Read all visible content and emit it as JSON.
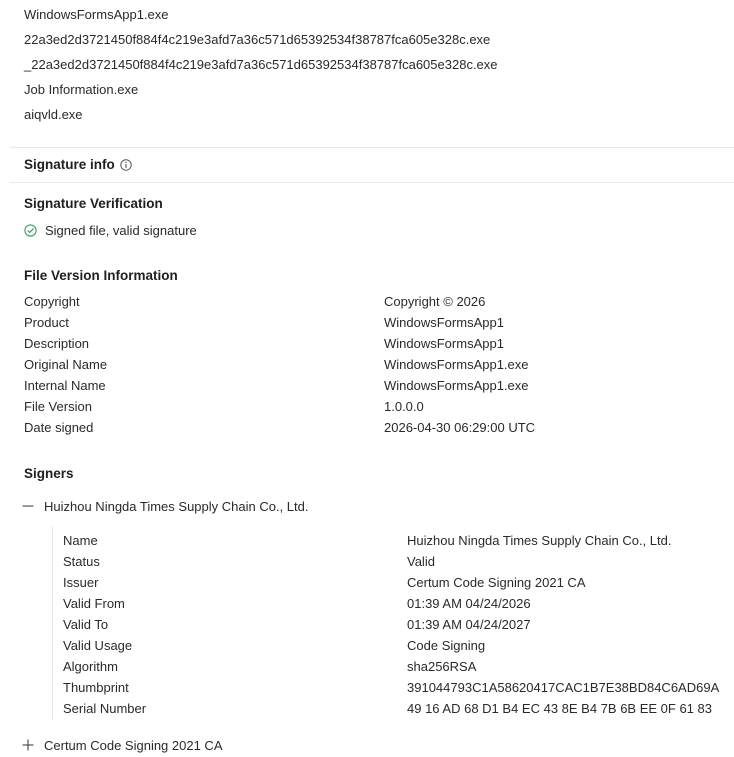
{
  "names": [
    "WindowsFormsApp1.exe",
    "22a3ed2d3721450f884f4c219e3afd7a36c571d65392534f38787fca605e328c.exe",
    "_22a3ed2d3721450f884f4c219e3afd7a36c571d65392534f38787fca605e328c.exe",
    "Job Information.exe",
    "aiqvld.exe"
  ],
  "signature_info": {
    "title": "Signature info",
    "info_icon": "info-circle-icon"
  },
  "signature_verification": {
    "title": "Signature Verification",
    "status_icon": "check-circle-icon",
    "status_color": "#3a9b5c",
    "status_text": "Signed file, valid signature"
  },
  "file_version_info": {
    "title": "File Version Information",
    "rows": [
      {
        "key": "Copyright",
        "value": "Copyright © 2026"
      },
      {
        "key": "Product",
        "value": "WindowsFormsApp1"
      },
      {
        "key": "Description",
        "value": "WindowsFormsApp1"
      },
      {
        "key": "Original Name",
        "value": "WindowsFormsApp1.exe"
      },
      {
        "key": "Internal Name",
        "value": "WindowsFormsApp1.exe"
      },
      {
        "key": "File Version",
        "value": "1.0.0.0"
      },
      {
        "key": "Date signed",
        "value": "2026-04-30 06:29:00 UTC"
      }
    ]
  },
  "signers": {
    "title": "Signers",
    "items": [
      {
        "name": "Huizhou Ningda Times Supply Chain Co., Ltd.",
        "expanded": true,
        "toggle_icon": "minus-icon",
        "details": [
          {
            "key": "Name",
            "value": "Huizhou Ningda Times Supply Chain Co., Ltd."
          },
          {
            "key": "Status",
            "value": "Valid"
          },
          {
            "key": "Issuer",
            "value": "Certum Code Signing 2021 CA"
          },
          {
            "key": "Valid From",
            "value": "01:39 AM 04/24/2026"
          },
          {
            "key": "Valid To",
            "value": "01:39 AM 04/24/2027"
          },
          {
            "key": "Valid Usage",
            "value": "Code Signing"
          },
          {
            "key": "Algorithm",
            "value": "sha256RSA"
          },
          {
            "key": "Thumbprint",
            "value": "391044793C1A58620417CAC1B7E38BD84C6AD69A"
          },
          {
            "key": "Serial Number",
            "value": "49 16 AD 68 D1 B4 EC 43 8E B4 7B 6B EE 0F 61 83"
          }
        ]
      },
      {
        "name": "Certum Code Signing 2021 CA",
        "expanded": false,
        "toggle_icon": "plus-icon"
      }
    ]
  }
}
